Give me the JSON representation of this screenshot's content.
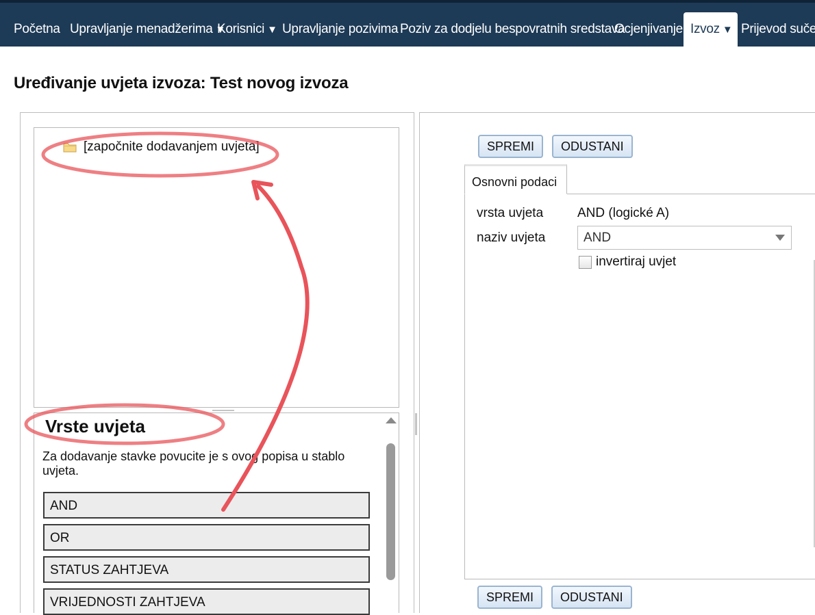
{
  "nav": {
    "items": [
      {
        "label": "Početna",
        "caret": ""
      },
      {
        "label": "Upravljanje menadžerima",
        "caret": "▼"
      },
      {
        "label": "Korisnici",
        "caret": "▼"
      },
      {
        "label": "Upravljanje pozivima",
        "caret": ""
      },
      {
        "label": "Poziv za dodjelu bespovratnih sredstava",
        "caret": ""
      },
      {
        "label": "Ocjenjivanje",
        "caret": ""
      },
      {
        "label": "Izvoz",
        "caret": "▼"
      },
      {
        "label": "Prijevod sučelja",
        "caret": ""
      }
    ],
    "active": "Izvoz",
    "color": "#1d3a56"
  },
  "page": {
    "title": "Uređivanje uvjeta izvoza: Test novog izvoza"
  },
  "tree": {
    "root_label": "[započnite dodavanjem uvjeta]",
    "root_icon": "folder-icon"
  },
  "condition_types": {
    "title": "Vrste uvjeta",
    "help": "Za dodavanje stavke povucite je s ovog popisa u stablo uvjeta.",
    "items": [
      "AND",
      "OR",
      "STATUS ZAHTJEVA",
      "VRIJEDNOSTI ZAHTJEVA"
    ]
  },
  "form": {
    "save_label": "SPREMI",
    "cancel_label": "ODUSTANI",
    "tab_label": "Osnovni podaci",
    "type_label": "vrsta uvjeta",
    "type_value": "AND (logické A)",
    "name_label": "naziv uvjeta",
    "name_value": "AND",
    "invert_label": "invertiraj uvjet",
    "invert_checked": false
  },
  "annotation_color": "#e8545a"
}
